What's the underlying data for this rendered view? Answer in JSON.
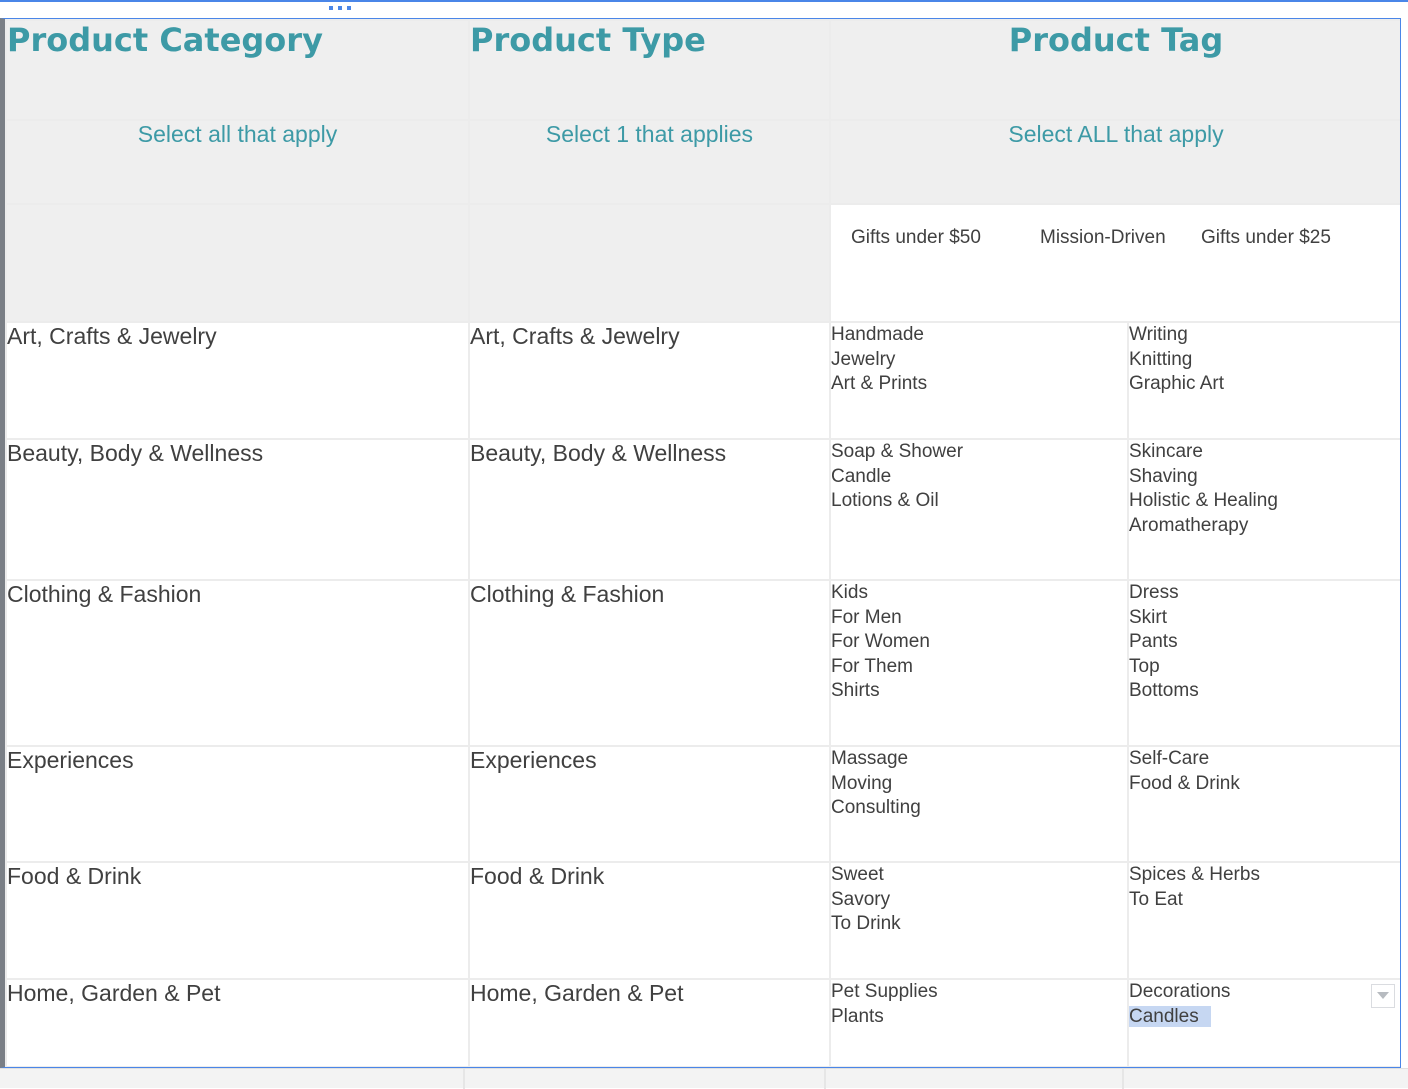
{
  "headers": {
    "category": {
      "title": "Product Category",
      "subtitle": "Select all that apply"
    },
    "type": {
      "title": "Product Type",
      "subtitle": "Select 1 that applies"
    },
    "tag": {
      "title": "Product Tag",
      "subtitle": "Select ALL that apply"
    }
  },
  "special_tags": [
    "Gifts under $50",
    "Mission-Driven",
    "Gifts under $25"
  ],
  "rows": [
    {
      "category": "Art, Crafts & Jewelry",
      "type": "Art, Crafts & Jewelry",
      "tags_a": [
        "Handmade",
        "Jewelry",
        "Art & Prints"
      ],
      "tags_b": [
        "Writing",
        "Knitting",
        "Graphic Art"
      ]
    },
    {
      "category": "Beauty, Body & Wellness",
      "type": "Beauty, Body & Wellness",
      "tags_a": [
        "Soap & Shower",
        "Candle",
        "Lotions & Oil"
      ],
      "tags_b": [
        "Skincare",
        "Shaving",
        "Holistic & Healing",
        "Aromatherapy"
      ]
    },
    {
      "category": "Clothing & Fashion",
      "type": "Clothing & Fashion",
      "tags_a": [
        "Kids",
        "For Men",
        "For Women",
        "For Them",
        "Shirts"
      ],
      "tags_b": [
        "Dress",
        "Skirt",
        "Pants",
        "Top",
        "Bottoms"
      ]
    },
    {
      "category": "Experiences",
      "type": "Experiences",
      "tags_a": [
        "Massage",
        "Moving",
        "Consulting"
      ],
      "tags_b": [
        "Self-Care",
        "Food & Drink"
      ]
    },
    {
      "category": "Food & Drink",
      "type": "Food & Drink",
      "tags_a": [
        "Sweet",
        "Savory",
        "To Drink"
      ],
      "tags_b": [
        "Spices & Herbs",
        "To Eat"
      ]
    },
    {
      "category": "Home, Garden & Pet",
      "type": "Home, Garden & Pet",
      "tags_a": [
        "Pet Supplies",
        "Plants"
      ],
      "tags_b": [
        "Decorations",
        "Candles"
      ]
    }
  ],
  "selection": {
    "highlighted_tag": "Candles"
  },
  "icons": {
    "drag_handle": "drag-handle-icon",
    "dropdown": "dropdown-arrow-icon"
  },
  "colors": {
    "accent": "#3d9aa6",
    "selection_border": "#4a86e8",
    "highlight": "#c6d7f2"
  }
}
